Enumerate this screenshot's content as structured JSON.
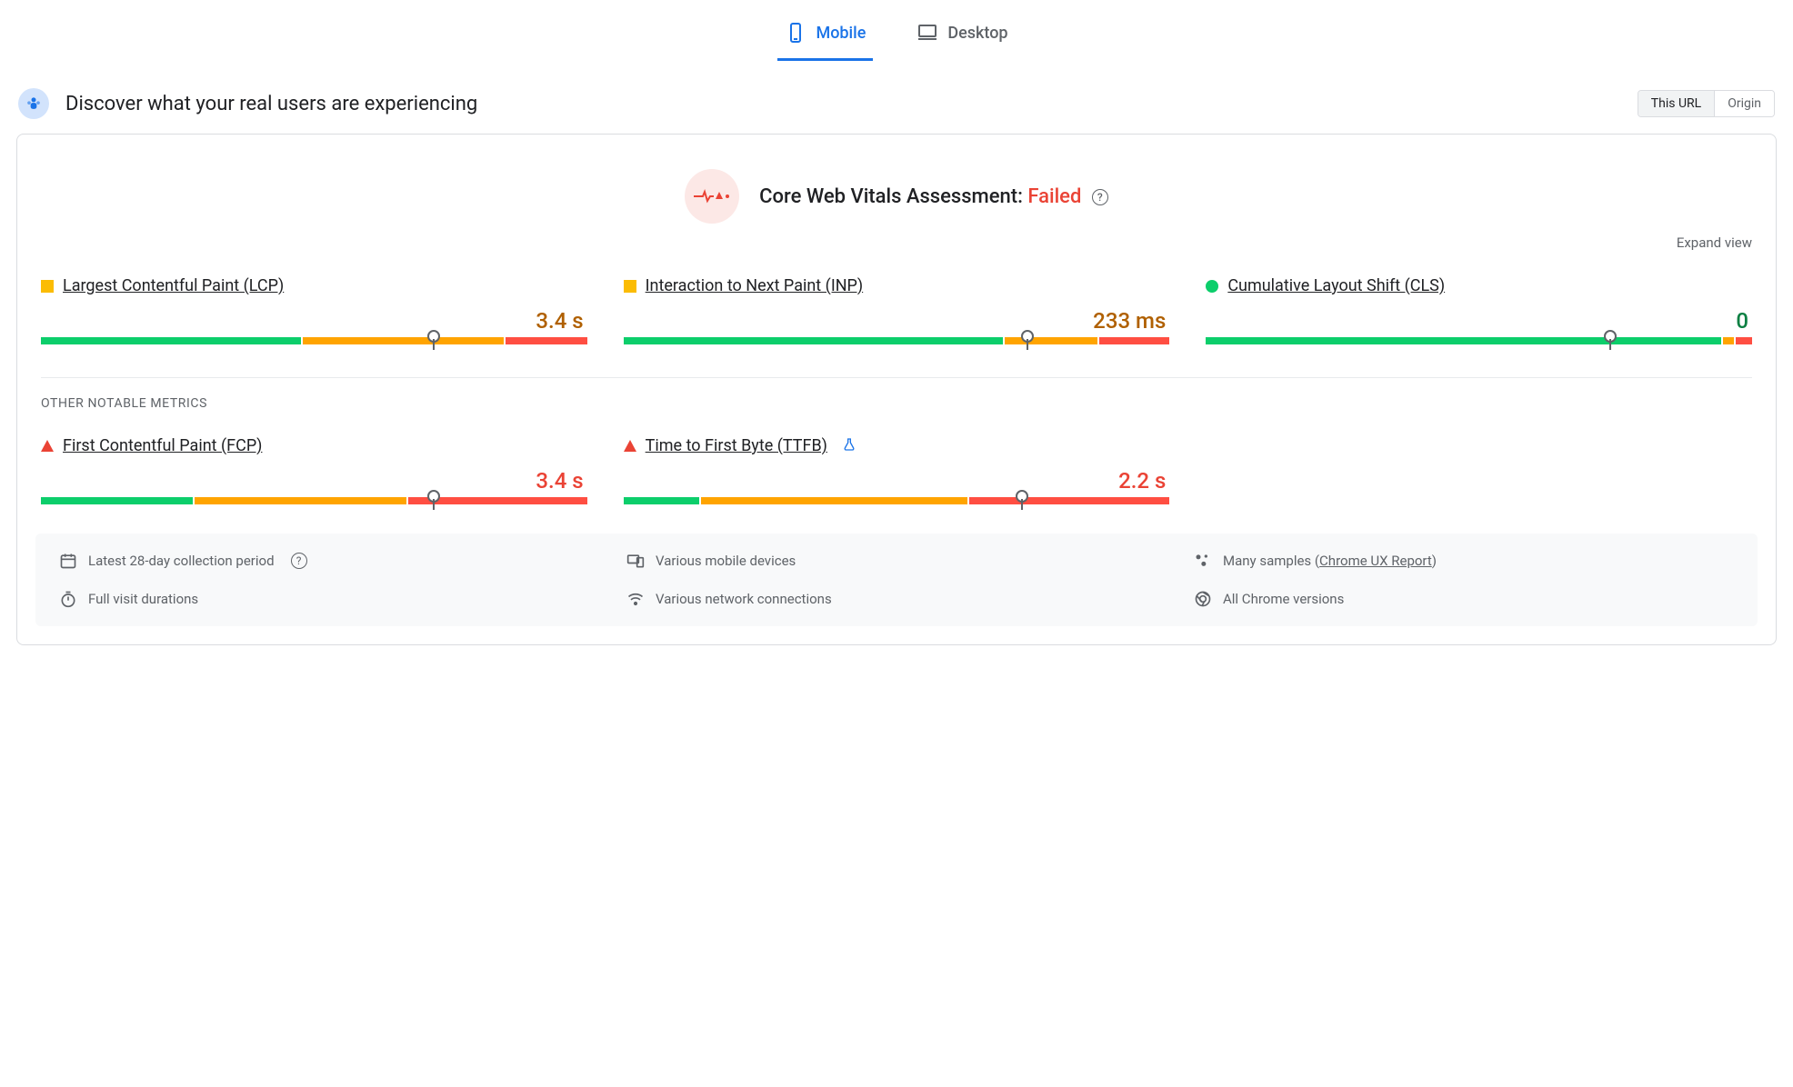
{
  "tabs": {
    "mobile": "Mobile",
    "desktop": "Desktop",
    "active": "mobile"
  },
  "header": {
    "title": "Discover what your real users are experiencing",
    "scope_this_url": "This URL",
    "scope_origin": "Origin"
  },
  "assessment": {
    "label": "Core Web Vitals Assessment: ",
    "status": "Failed"
  },
  "expand_label": "Expand view",
  "section_other_label": "OTHER NOTABLE METRICS",
  "metrics": {
    "lcp": {
      "name": "Largest Contentful Paint (LCP)",
      "value": "3.4 s",
      "status": "orange",
      "segments": {
        "green": 48,
        "orange": 37,
        "red": 15
      },
      "marker_pct": 72
    },
    "inp": {
      "name": "Interaction to Next Paint (INP)",
      "value": "233 ms",
      "status": "orange",
      "segments": {
        "green": 70,
        "orange": 17,
        "red": 13
      },
      "marker_pct": 74
    },
    "cls": {
      "name": "Cumulative Layout Shift (CLS)",
      "value": "0",
      "status": "green",
      "segments": {
        "green": 95,
        "orange": 2,
        "red": 3
      },
      "marker_pct": 74
    },
    "fcp": {
      "name": "First Contentful Paint (FCP)",
      "value": "3.4 s",
      "status": "red",
      "segments": {
        "green": 28,
        "orange": 39,
        "red": 33
      },
      "marker_pct": 72
    },
    "ttfb": {
      "name": "Time to First Byte (TTFB)",
      "value": "2.2 s",
      "status": "red",
      "experimental": true,
      "segments": {
        "green": 14,
        "orange": 49,
        "red": 37
      },
      "marker_pct": 73
    }
  },
  "footer": {
    "period": "Latest 28-day collection period",
    "devices": "Various mobile devices",
    "samples_prefix": "Many samples (",
    "samples_link": "Chrome UX Report",
    "samples_suffix": ")",
    "durations": "Full visit durations",
    "connections": "Various network connections",
    "versions": "All Chrome versions"
  }
}
